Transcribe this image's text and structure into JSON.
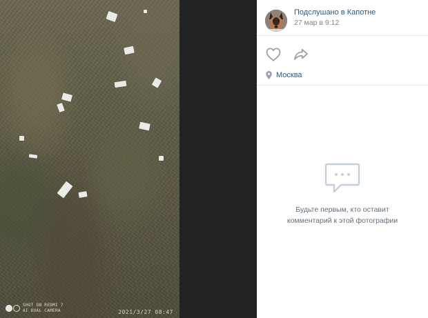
{
  "photo": {
    "watermark": {
      "line1": "SHOT ON REDMI 7",
      "line2": "AI DUAL CAMERA"
    },
    "timestamp": "2021/3/27  08:47"
  },
  "post": {
    "author": "Подслушано в Капотне",
    "date": "27 мар в 9:12"
  },
  "actions": {
    "like_icon": "heart-icon",
    "share_icon": "share-arrow-icon"
  },
  "location": {
    "icon": "map-pin-icon",
    "label": "Москва"
  },
  "comments": {
    "icon": "speech-bubble-icon",
    "empty_text": "Будьте первым, кто оставит комментарий к этой фотографии"
  },
  "colors": {
    "link": "#2a5885",
    "muted": "#828282",
    "icon": "#99a2ad",
    "viewer_bg": "#222222"
  }
}
